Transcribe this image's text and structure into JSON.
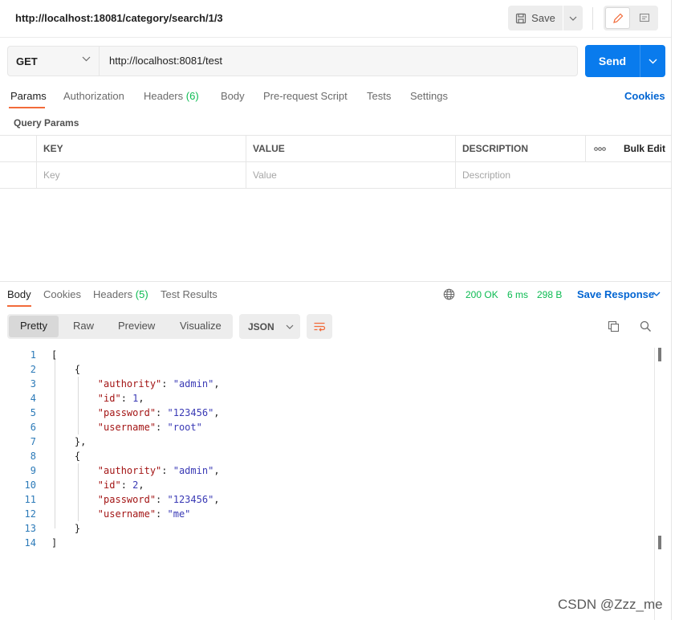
{
  "header": {
    "request_title": "http://localhost:18081/category/search/1/3",
    "save_label": "Save"
  },
  "request": {
    "method": "GET",
    "url": "http://localhost:8081/test",
    "send_label": "Send"
  },
  "request_tabs": {
    "params": "Params",
    "authorization": "Authorization",
    "headers": "Headers",
    "headers_count": "(6)",
    "body": "Body",
    "pre_request": "Pre-request Script",
    "tests": "Tests",
    "settings": "Settings",
    "cookies": "Cookies"
  },
  "query_params": {
    "title": "Query Params",
    "columns": {
      "key": "KEY",
      "value": "VALUE",
      "description": "DESCRIPTION"
    },
    "more": "ooo",
    "bulk_edit": "Bulk Edit",
    "placeholders": {
      "key": "Key",
      "value": "Value",
      "description": "Description"
    }
  },
  "response_tabs": {
    "body": "Body",
    "cookies": "Cookies",
    "headers": "Headers",
    "headers_count": "(5)",
    "test_results": "Test Results"
  },
  "response_status": {
    "status": "200 OK",
    "time": "6 ms",
    "size": "298 B",
    "save_response": "Save Response"
  },
  "view_modes": {
    "pretty": "Pretty",
    "raw": "Raw",
    "preview": "Preview",
    "visualize": "Visualize",
    "format": "JSON"
  },
  "response_body": {
    "lines": [
      {
        "n": "1",
        "text": "["
      },
      {
        "n": "2",
        "text": "    {"
      },
      {
        "n": "3",
        "key": "\"authority\"",
        "val": "\"admin\"",
        "tail": ","
      },
      {
        "n": "4",
        "key": "\"id\"",
        "val": "1",
        "tail": ","
      },
      {
        "n": "5",
        "key": "\"password\"",
        "val": "\"123456\"",
        "tail": ","
      },
      {
        "n": "6",
        "key": "\"username\"",
        "val": "\"root\"",
        "tail": ""
      },
      {
        "n": "7",
        "text": "    },"
      },
      {
        "n": "8",
        "text": "    {"
      },
      {
        "n": "9",
        "key": "\"authority\"",
        "val": "\"admin\"",
        "tail": ","
      },
      {
        "n": "10",
        "key": "\"id\"",
        "val": "2",
        "tail": ","
      },
      {
        "n": "11",
        "key": "\"password\"",
        "val": "\"123456\"",
        "tail": ","
      },
      {
        "n": "12",
        "key": "\"username\"",
        "val": "\"me\"",
        "tail": ""
      },
      {
        "n": "13",
        "text": "    }"
      },
      {
        "n": "14",
        "text": "]"
      }
    ]
  },
  "watermark": "CSDN @Zzz_me",
  "colors": {
    "accent": "#f26b3a",
    "primary": "#097bed",
    "link": "#0265d2",
    "success": "#0cbb52"
  }
}
